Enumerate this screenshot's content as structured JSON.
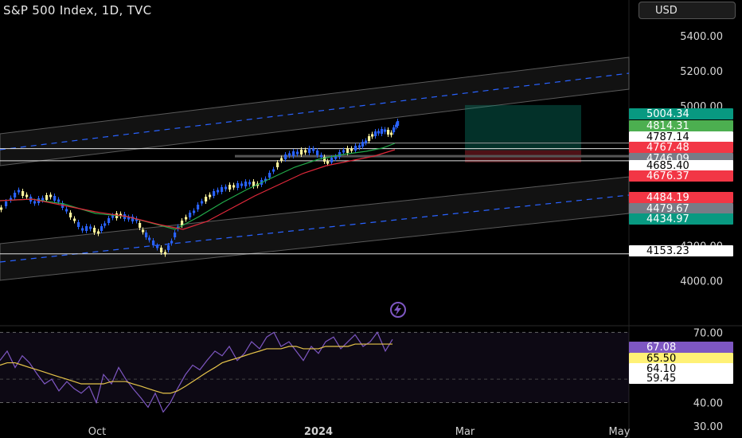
{
  "header": {
    "title": "S&P 500 Index, 1D, TVC",
    "currency": "USD"
  },
  "colors": {
    "up": "#2962ff",
    "down": "#fff59d",
    "ma_fast": "#22aa4a",
    "ma_slow": "#e0283a",
    "rsi": "#7e57c2",
    "rsi_ma": "#e6c44a",
    "channel_mid": "#2962ff"
  },
  "icons": {
    "replay": "lightning-bolt-icon"
  },
  "chart_data": [
    {
      "type": "candlestick",
      "x_ticks": [
        "Oct",
        "2024",
        "Mar",
        "May"
      ],
      "y_ticks": [
        4000,
        4200,
        5000,
        5200,
        5400
      ],
      "y_tick_labels": [
        "4000.00",
        "4200.00",
        "5000.00",
        "5200.00",
        "5400.00"
      ],
      "ylim": [
        3800,
        5600
      ],
      "series": [
        {
          "label": "5004.34",
          "value": 5004.34,
          "color": "#089981"
        },
        {
          "label": "4814.31",
          "value": 4814.31,
          "color": "#4caf50"
        },
        {
          "label": "4787.14",
          "value": 4787.14,
          "color": "#ffffff"
        },
        {
          "label": "4767.48",
          "value": 4767.48,
          "color": "#f23645"
        },
        {
          "label": "4746.09",
          "value": 4746.09,
          "color": "#787b86"
        },
        {
          "label": "4685.40",
          "value": 4685.4,
          "color": "#ffffff"
        },
        {
          "label": "4676.37",
          "value": 4676.37,
          "color": "#f23645"
        },
        {
          "label": "4484.19",
          "value": 4484.19,
          "color": "#f23645"
        },
        {
          "label": "4479.67",
          "value": 4479.67,
          "color": "#787b86"
        },
        {
          "label": "4434.97",
          "value": 4434.97,
          "color": "#089981"
        },
        {
          "label": "4153.23",
          "value": 4153.23,
          "color": "#ffffff"
        }
      ],
      "horizontal_lines": [
        4787.14,
        4746.09,
        4685.4,
        4153.23
      ],
      "trade_box": {
        "entry": 4746.09,
        "target": 5004.34,
        "stop": 4676.37
      }
    },
    {
      "type": "line",
      "name": "RSI",
      "y_ticks": [
        30,
        40,
        70
      ],
      "y_tick_labels": [
        "30.00",
        "40.00",
        "70.00"
      ],
      "ylim": [
        30,
        72
      ],
      "band": [
        40,
        70
      ],
      "series": [
        {
          "label": "67.08",
          "value": 67.08,
          "color": "#7e57c2"
        },
        {
          "label": "65.50",
          "value": 65.5,
          "color": "#fff176"
        },
        {
          "label": "64.10",
          "value": 64.1,
          "color": "#ffffff"
        },
        {
          "label": "59.45",
          "value": 59.45,
          "color": "#ffffff"
        }
      ]
    }
  ]
}
